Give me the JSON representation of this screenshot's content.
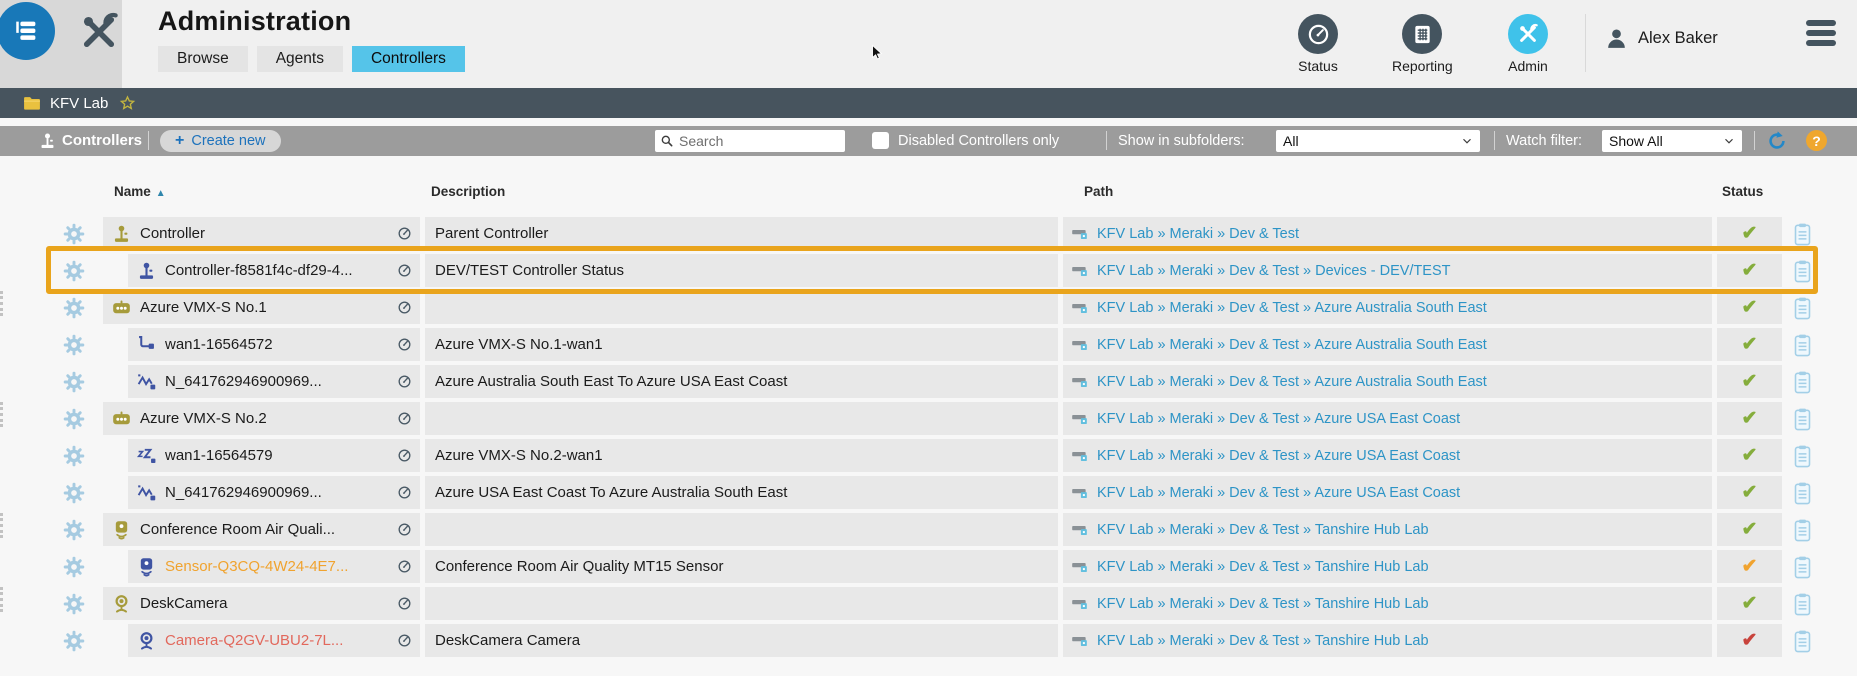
{
  "header": {
    "title": "Administration",
    "tabs": [
      {
        "label": "Browse"
      },
      {
        "label": "Agents"
      },
      {
        "label": "Controllers"
      }
    ],
    "nav": [
      {
        "label": "Status"
      },
      {
        "label": "Reporting"
      },
      {
        "label": "Admin"
      }
    ],
    "user_name": "Alex Baker"
  },
  "breadcrumb": {
    "label": "KFV Lab"
  },
  "toolbar": {
    "section_label": "Controllers",
    "create_plus": "+",
    "create_label": "Create new",
    "search_placeholder": "Search",
    "checkbox_label": "Disabled Controllers only",
    "subfolders_label": "Show in subfolders:",
    "subfolders_value": "All",
    "watch_label": "Watch filter:",
    "watch_value": "Show All",
    "help_label": "?"
  },
  "table": {
    "columns": [
      "Name",
      "Description",
      "Path",
      "Status"
    ],
    "sort_glyph": "▲",
    "check_glyph": "✔",
    "rows": [
      {
        "icon": "joystick",
        "icon_color": "olive",
        "name": "Controller",
        "desc": "Parent Controller",
        "path": "KFV Lab » Meraki » Dev & Test",
        "status": "green",
        "indent": false,
        "handle": false,
        "gauge": false,
        "clipboard": false,
        "highlighted": false
      },
      {
        "icon": "joystick",
        "icon_color": "blue",
        "name": "Controller-f8581f4c-df29-4...",
        "desc": "DEV/TEST Controller Status",
        "path": "KFV Lab » Meraki » Dev & Test » Devices - DEV/TEST",
        "status": "green",
        "indent": true,
        "handle": false,
        "gauge": false,
        "clipboard": false,
        "highlighted": true
      },
      {
        "icon": "robot",
        "icon_color": "olive",
        "name": "Azure VMX-S No.1",
        "desc": "",
        "path": "KFV Lab » Meraki » Dev & Test » Azure Australia South East",
        "status": "green",
        "indent": false,
        "handle": true,
        "gauge": false,
        "clipboard": true,
        "highlighted": false
      },
      {
        "icon": "branch",
        "icon_color": "blue",
        "name": "wan1-16564572",
        "desc": "Azure VMX-S No.1-wan1",
        "path": "KFV Lab » Meraki » Dev & Test » Azure Australia South East",
        "status": "green",
        "indent": true,
        "handle": false,
        "gauge": true,
        "clipboard": false,
        "highlighted": false
      },
      {
        "icon": "wave",
        "icon_color": "blue",
        "name": "N_641762946900969...",
        "desc": "Azure Australia South East To Azure USA East Coast",
        "path": "KFV Lab » Meraki » Dev & Test » Azure Australia South East",
        "status": "green",
        "indent": true,
        "handle": false,
        "gauge": true,
        "clipboard": false,
        "highlighted": false
      },
      {
        "icon": "robot",
        "icon_color": "olive",
        "name": "Azure VMX-S No.2",
        "desc": "",
        "path": "KFV Lab » Meraki » Dev & Test » Azure USA East Coast",
        "status": "green",
        "indent": false,
        "handle": true,
        "gauge": false,
        "clipboard": true,
        "highlighted": false
      },
      {
        "icon": "sleep",
        "icon_color": "blue",
        "name": "wan1-16564579",
        "desc": "Azure VMX-S No.2-wan1",
        "path": "KFV Lab » Meraki » Dev & Test » Azure USA East Coast",
        "status": "green",
        "indent": true,
        "handle": false,
        "gauge": true,
        "clipboard": false,
        "highlighted": false
      },
      {
        "icon": "wave",
        "icon_color": "blue",
        "name": "N_641762946900969...",
        "desc": "Azure USA East Coast To Azure Australia South East",
        "path": "KFV Lab » Meraki » Dev & Test » Azure USA East Coast",
        "status": "green",
        "indent": true,
        "handle": false,
        "gauge": true,
        "clipboard": false,
        "highlighted": false
      },
      {
        "icon": "sensor",
        "icon_color": "olive",
        "name": "Conference Room Air Quali...",
        "desc": "",
        "path": "KFV Lab » Meraki » Dev & Test » Tanshire Hub Lab",
        "status": "green",
        "indent": false,
        "handle": true,
        "gauge": false,
        "clipboard": true,
        "highlighted": false
      },
      {
        "icon": "sensor",
        "icon_color": "blue",
        "name": "Sensor-Q3CQ-4W24-4E7...",
        "name_color": "orange",
        "desc": "Conference Room Air Quality MT15 Sensor",
        "path": "KFV Lab » Meraki » Dev & Test » Tanshire Hub Lab",
        "status": "orange",
        "indent": true,
        "handle": false,
        "gauge": false,
        "clipboard": false,
        "highlighted": false
      },
      {
        "icon": "webcam",
        "icon_color": "olive",
        "name": "DeskCamera",
        "desc": "",
        "path": "KFV Lab » Meraki » Dev & Test » Tanshire Hub Lab",
        "status": "green",
        "indent": false,
        "handle": true,
        "gauge": false,
        "clipboard": true,
        "highlighted": false
      },
      {
        "icon": "webcam",
        "icon_color": "blue",
        "name": "Camera-Q2GV-UBU2-7L...",
        "name_color": "red",
        "desc": "DeskCamera Camera",
        "path": "KFV Lab » Meraki » Dev & Test » Tanshire Hub Lab",
        "status": "red",
        "indent": true,
        "handle": false,
        "gauge": false,
        "clipboard": false,
        "highlighted": false
      }
    ]
  },
  "colors": {
    "accent_blue": "#55C4E9",
    "link_blue": "#2D94C6",
    "olive_icon": "#A69B3B",
    "device_blue": "#3F54A3",
    "ok_green": "#85AD3C",
    "warn_orange": "#F0A32F",
    "error_red": "#C8433C",
    "highlight_orange": "#E9A41C",
    "toolbar_gray": "#9C9C9C",
    "bar_slate": "#47545E"
  }
}
